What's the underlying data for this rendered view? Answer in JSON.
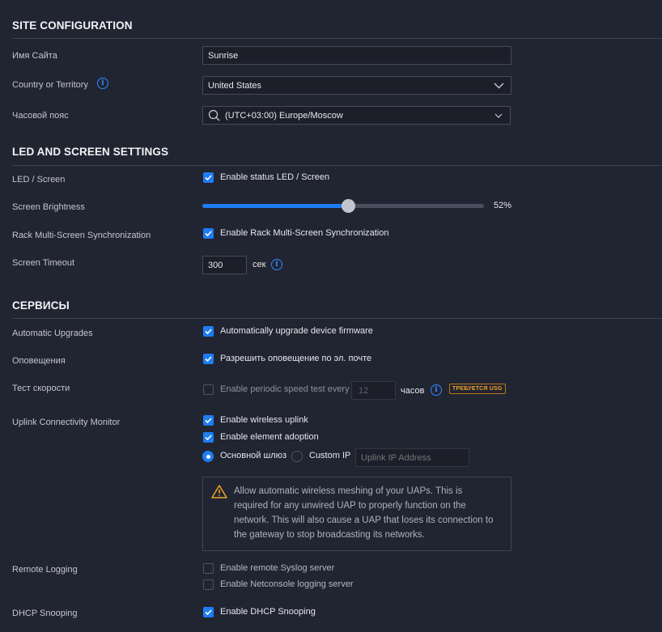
{
  "site": {
    "title": "SITE CONFIGURATION",
    "name_label": "Имя Сайта",
    "name_value": "Sunrise",
    "country_label": "Country or Territory",
    "country_value": "United States",
    "tz_label": "Часовой пояс",
    "tz_value": "(UTC+03:00) Europe/Moscow"
  },
  "led": {
    "title": "LED AND SCREEN SETTINGS",
    "led_label": "LED / Screen",
    "led_option": "Enable status LED / Screen",
    "led_checked": true,
    "brightness_label": "Screen Brightness",
    "brightness_value": 52,
    "brightness_text": "52%",
    "rack_label": "Rack Multi-Screen Synchronization",
    "rack_option": "Enable Rack Multi-Screen Synchronization",
    "rack_checked": true,
    "timeout_label": "Screen Timeout",
    "timeout_value": "300",
    "timeout_unit": "сек"
  },
  "services": {
    "title": "СЕРВИСЫ",
    "upgrades_label": "Automatic Upgrades",
    "upgrades_option": "Automatically upgrade device firmware",
    "notify_label": "Оповещения",
    "notify_option": "Разрешить оповещение по эл. почте",
    "speed_label": "Тест скорости",
    "speed_option": "Enable periodic speed test every",
    "speed_value": "12",
    "speed_unit": "часов",
    "speed_badge": "ТРЕБУЕТСЯ USG",
    "uplink_label": "Uplink Connectivity Monitor",
    "uplink_opt1": "Enable wireless uplink",
    "uplink_opt2": "Enable element adoption",
    "radio_gateway": "Основной шлюз",
    "radio_custom": "Custom IP",
    "uplink_ip_placeholder": "Uplink IP Address",
    "alert_lines": [
      "Allow automatic wireless meshing of your UAPs. This is",
      "required for any unwired UAP to properly function on the",
      "network. This will also cause a UAP that loses its connection to",
      "the gateway to stop broadcasting its networks."
    ],
    "logging_label": "Remote Logging",
    "syslog_option": "Enable remote Syslog server",
    "netconsole_option": "Enable Netconsole logging server",
    "dhcp_label": "DHCP Snooping",
    "dhcp_option": "Enable DHCP Snooping"
  },
  "icons": {
    "check": "check-icon",
    "info": "info-icon",
    "chevron": "chevron-down-icon",
    "search": "search-icon",
    "warning": "warning-icon"
  },
  "colors": {
    "background": "#212431",
    "accent": "#1e7cf4",
    "warning": "#f0a329"
  }
}
